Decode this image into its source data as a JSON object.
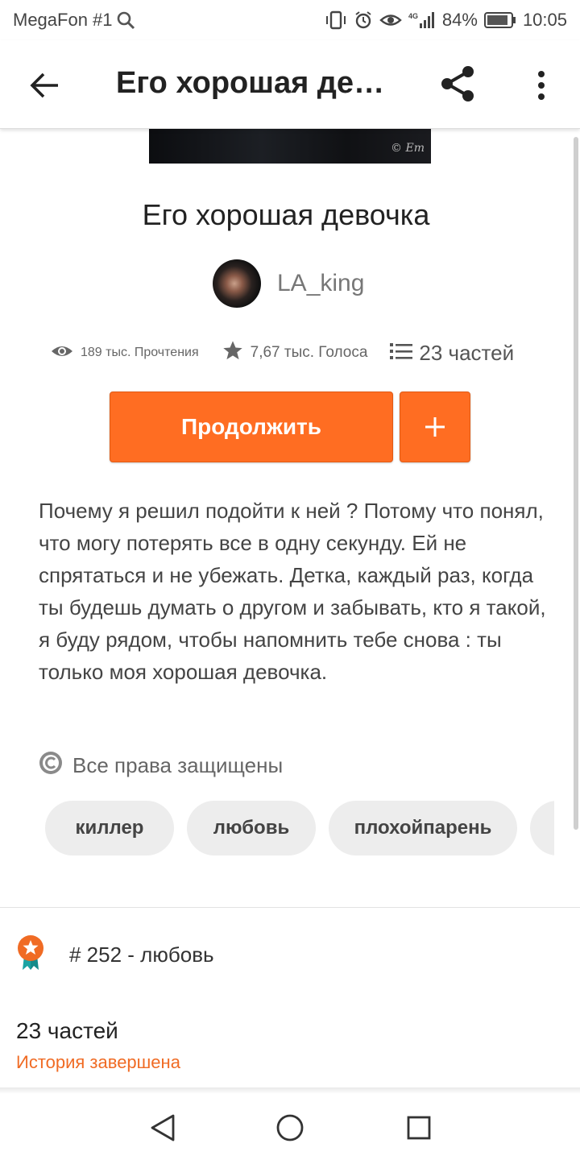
{
  "status_bar": {
    "carrier": "MegaFon #1",
    "network": "4G",
    "battery": "84%",
    "time": "10:05",
    "icons": [
      "search-icon",
      "vibrate-icon",
      "alarm-icon",
      "eye-icon",
      "signal-icon",
      "battery-icon"
    ]
  },
  "app_bar": {
    "title": "Его хорошая девочка",
    "icons": [
      "back-arrow-icon",
      "share-icon",
      "more-vert-icon"
    ]
  },
  "cover": {
    "watermark": "© Em"
  },
  "story": {
    "title": "Его хорошая девочка",
    "author": "LA_king",
    "reads": "189 тыс. Прочтения",
    "votes": "7,67 тыс. Голоса",
    "parts": "23 частей",
    "continue_label": "Продолжить",
    "add_label": "+",
    "description": "Почему я решил подойти к ней ? Потому что понял, что могу потерять все в одну секунду. Ей не спрятаться и не убежать. Детка, каждый раз, когда ты будешь думать о другом и забывать, кто я такой, я буду рядом, чтобы напомнить тебе снова : ты только моя хорошая девочка.",
    "copyright": "Все права защищены",
    "tags": [
      "киллер",
      "любовь",
      "плохойпарень"
    ]
  },
  "ranking": {
    "text": "# 252 - любовь"
  },
  "toc": {
    "parts_count": "23 частей",
    "status": "История завершена"
  },
  "colors": {
    "accent": "#ff6d22",
    "completed_text": "#f06b24",
    "tag_bg": "#ededed",
    "badge_orange": "#f06b24",
    "badge_ribbon": "#1aa3a3"
  },
  "nav_bar": {
    "icons": [
      "nav-back-icon",
      "nav-home-icon",
      "nav-recents-icon"
    ]
  }
}
